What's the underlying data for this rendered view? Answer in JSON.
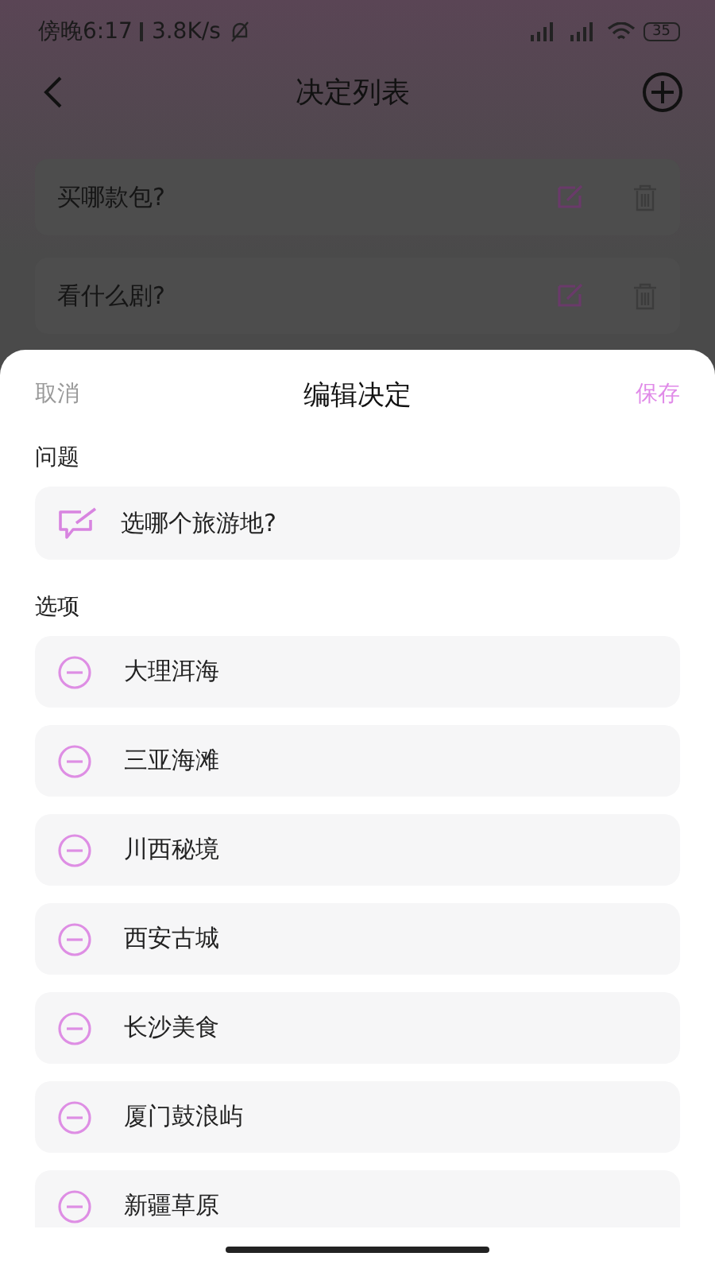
{
  "status_bar": {
    "time": "傍晚6:17",
    "speed": "3.8K/s",
    "battery": "35"
  },
  "header": {
    "title": "决定列表"
  },
  "decisions": [
    {
      "title": "买哪款包?"
    },
    {
      "title": "看什么剧?"
    }
  ],
  "sheet": {
    "cancel": "取消",
    "title": "编辑决定",
    "save": "保存",
    "question_label": "问题",
    "question": "选哪个旅游地?",
    "options_label": "选项",
    "options": [
      "大理洱海",
      "三亚海滩",
      "川西秘境",
      "西安古城",
      "长沙美食",
      "厦门鼓浪屿",
      "新疆草原"
    ]
  }
}
